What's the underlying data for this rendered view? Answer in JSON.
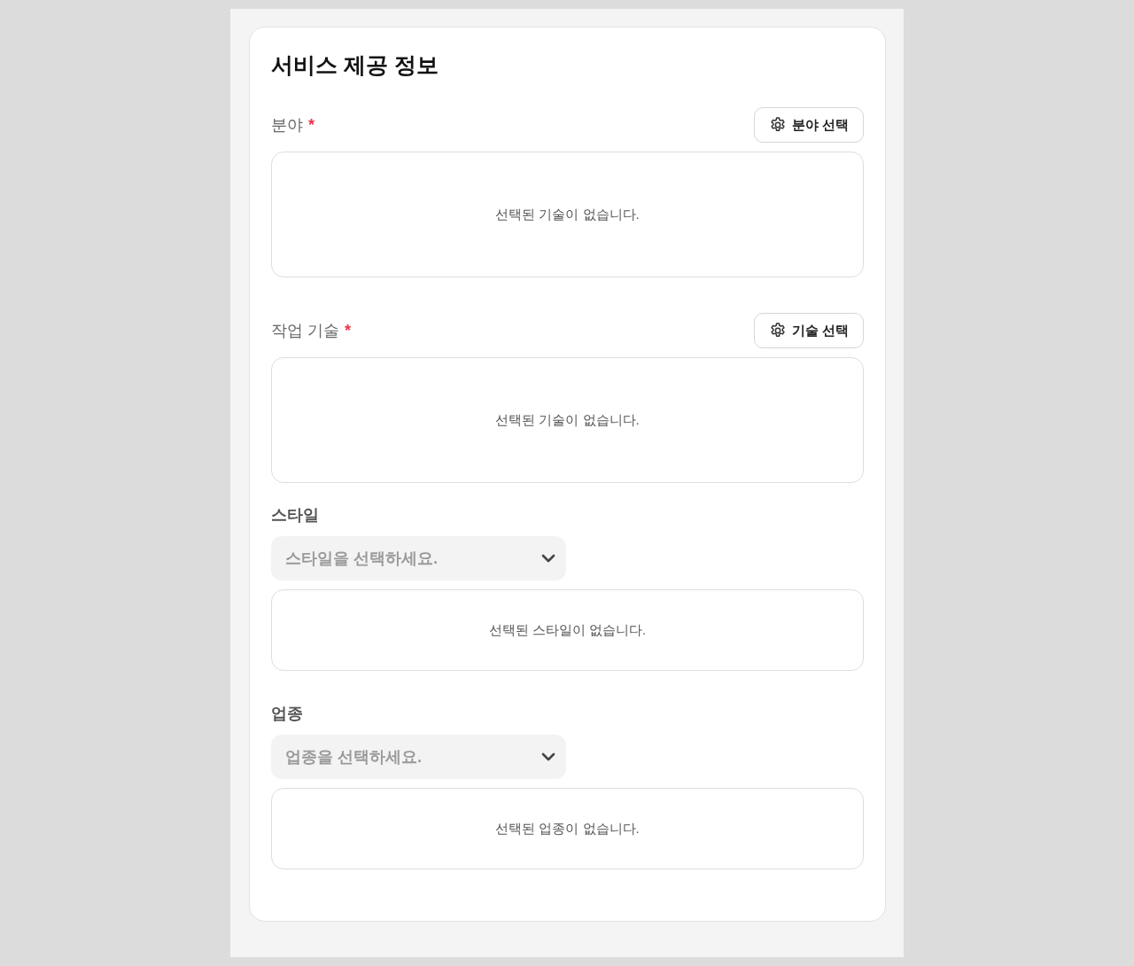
{
  "title": "서비스 제공 정보",
  "sections": [
    {
      "kind": "picker",
      "label": "분야",
      "required_mark": "*",
      "button": "분야 선택",
      "empty": "선택된 기술이 없습니다."
    },
    {
      "kind": "picker",
      "label": "작업 기술",
      "required_mark": "*",
      "button": "기술 선택",
      "empty": "선택된 기술이 없습니다."
    },
    {
      "kind": "dropdown",
      "label": "스타일",
      "placeholder": "스타일을 선택하세요.",
      "empty": "선택된 스타일이 없습니다."
    },
    {
      "kind": "dropdown",
      "label": "업종",
      "placeholder": "업종을 선택하세요.",
      "empty": "선택된 업종이 없습니다."
    }
  ]
}
